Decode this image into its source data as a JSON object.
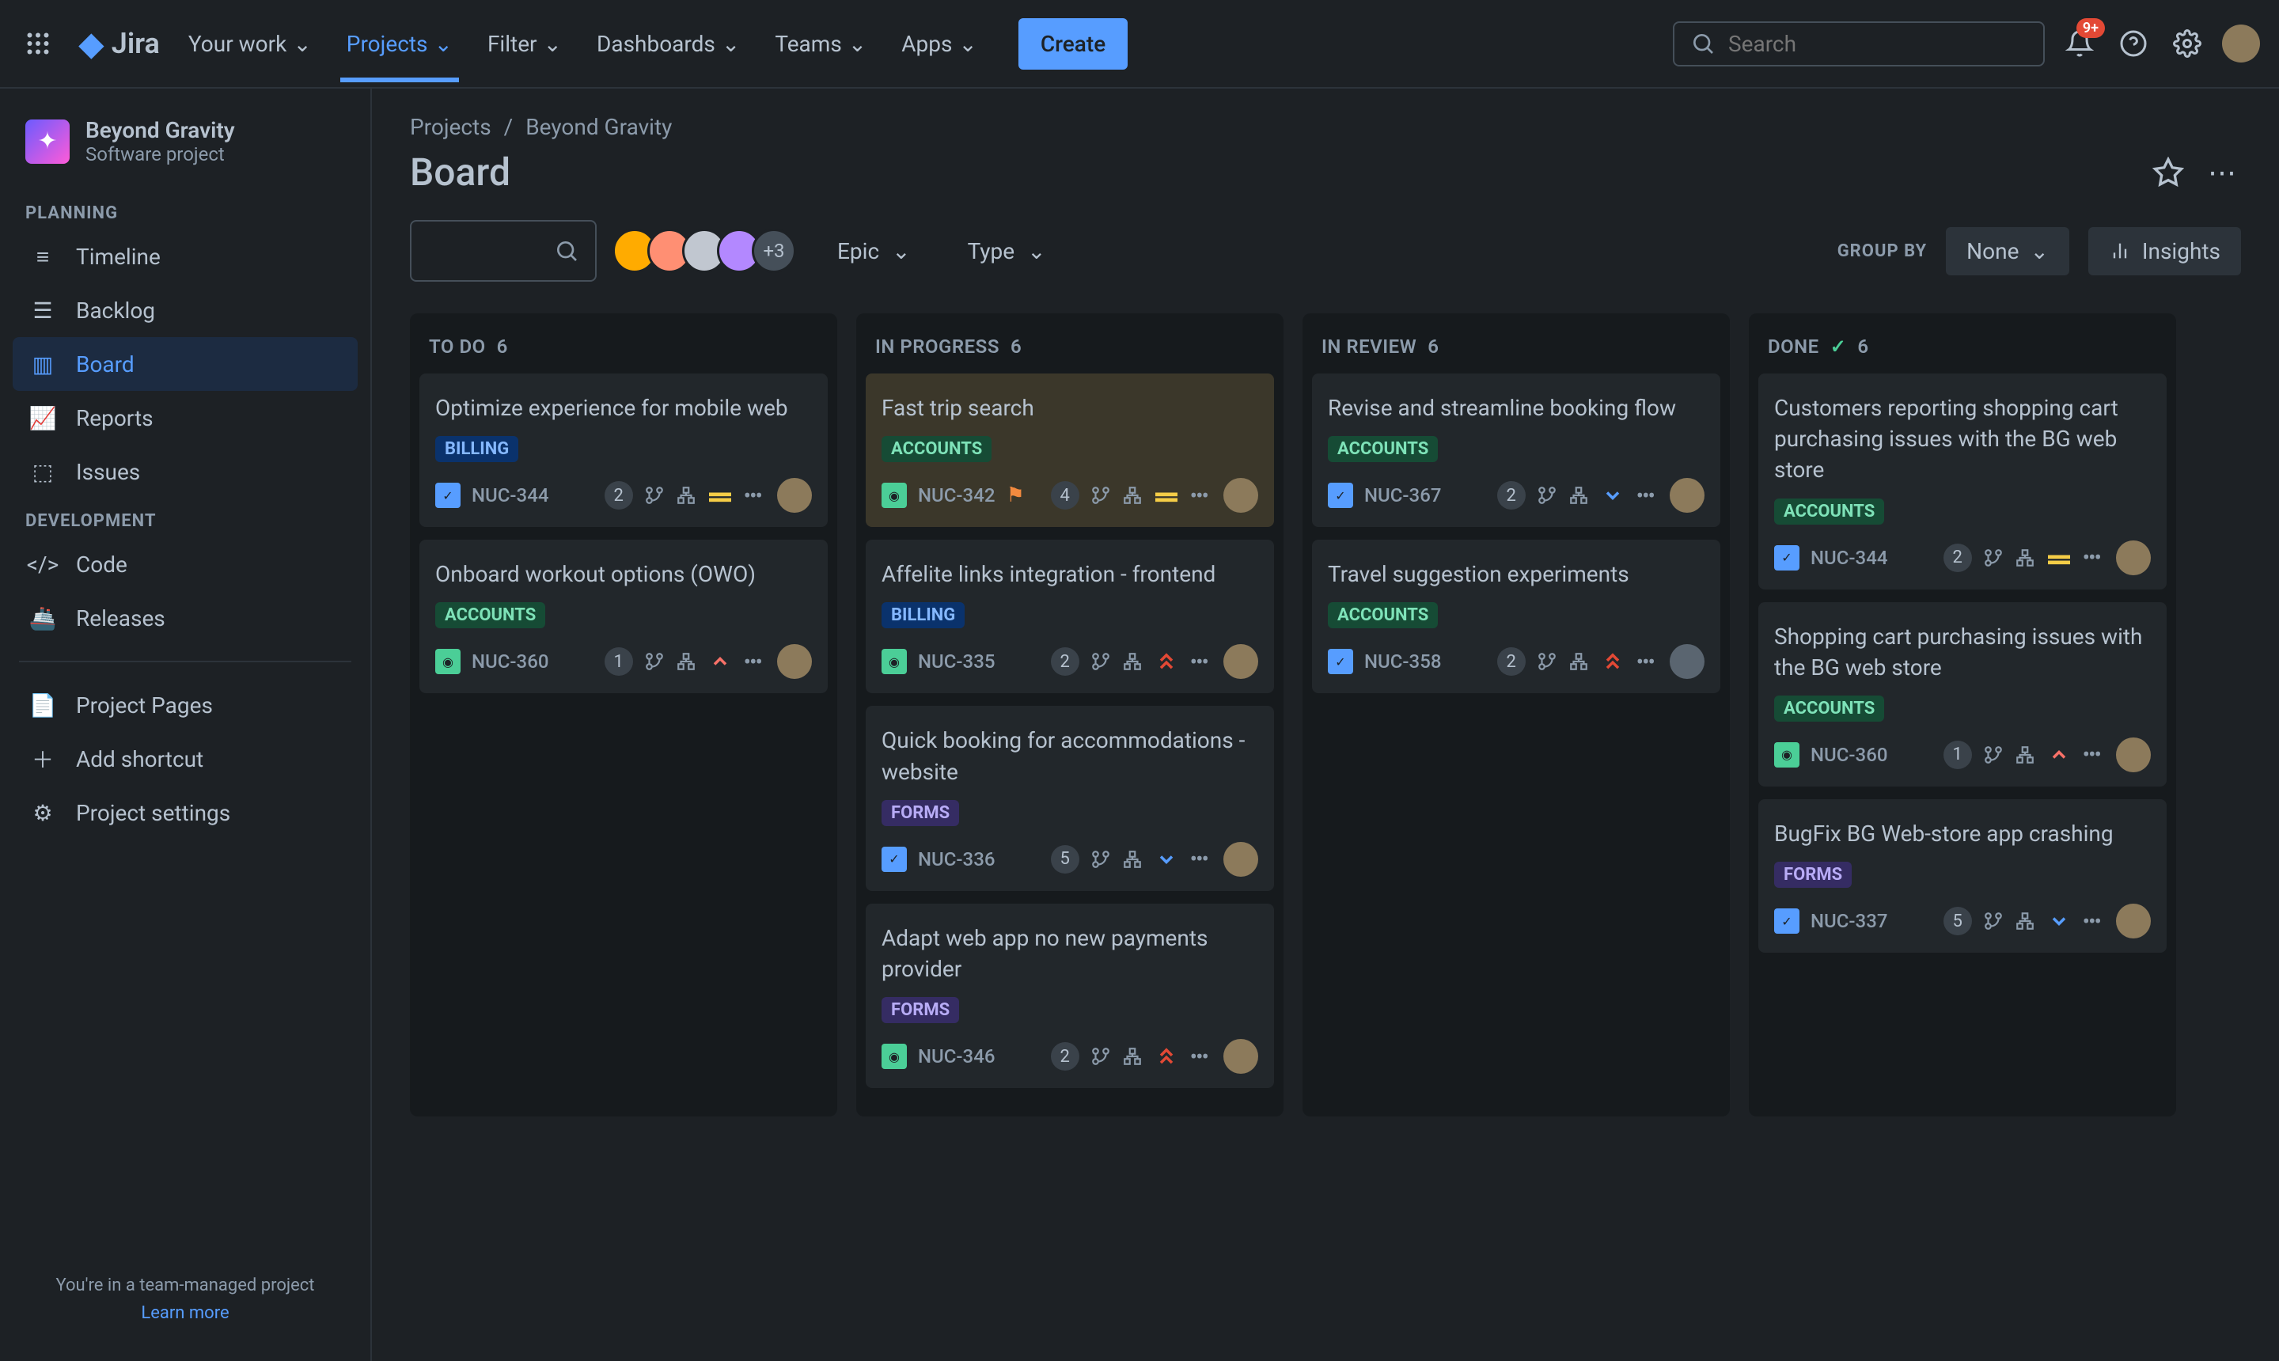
{
  "topbar": {
    "logo": "Jira",
    "nav": [
      "Your work",
      "Projects",
      "Filter",
      "Dashboards",
      "Teams",
      "Apps"
    ],
    "create": "Create",
    "search_placeholder": "Search",
    "notification_badge": "9+"
  },
  "sidebar": {
    "project_name": "Beyond Gravity",
    "project_sub": "Software project",
    "sections": {
      "planning": {
        "label": "PLANNING",
        "items": [
          "Timeline",
          "Backlog",
          "Board",
          "Reports",
          "Issues"
        ]
      },
      "development": {
        "label": "DEVELOPMENT",
        "items": [
          "Code",
          "Releases"
        ]
      },
      "other": {
        "items": [
          "Project Pages",
          "Add shortcut",
          "Project settings"
        ]
      }
    },
    "footer_text": "You're in a team-managed project",
    "footer_link": "Learn more"
  },
  "main": {
    "breadcrumb": [
      "Projects",
      "Beyond Gravity"
    ],
    "title": "Board",
    "avatar_overflow": "+3",
    "filters": [
      "Epic",
      "Type"
    ],
    "group_by_label": "GROUP BY",
    "group_by_value": "None",
    "insights": "Insights"
  },
  "columns": [
    {
      "name": "TO DO",
      "count": "6",
      "cards": [
        {
          "title": "Optimize experience for mobile web",
          "tag": "BILLING",
          "tag_class": "billing",
          "type": "task",
          "key": "NUC-344",
          "count": "2",
          "priority": "medium",
          "assignee": "a"
        },
        {
          "title": "Onboard workout options (OWO)",
          "tag": "ACCOUNTS",
          "tag_class": "accounts",
          "type": "story",
          "key": "NUC-360",
          "count": "1",
          "priority": "high",
          "assignee": "a"
        }
      ]
    },
    {
      "name": "IN PROGRESS",
      "count": "6",
      "cards": [
        {
          "title": "Fast trip search",
          "tag": "ACCOUNTS",
          "tag_class": "accounts",
          "type": "story",
          "key": "NUC-342",
          "flag": true,
          "count": "4",
          "priority": "medium",
          "assignee": "a",
          "highlight": true
        },
        {
          "title": "Affelite links integration - frontend",
          "tag": "BILLING",
          "tag_class": "billing",
          "type": "story",
          "key": "NUC-335",
          "count": "2",
          "priority": "highest",
          "assignee": "a"
        },
        {
          "title": "Quick booking for accommodations - website",
          "tag": "FORMS",
          "tag_class": "forms",
          "type": "task",
          "key": "NUC-336",
          "count": "5",
          "priority": "low",
          "assignee": "a"
        },
        {
          "title": "Adapt web app no new payments provider",
          "tag": "FORMS",
          "tag_class": "forms",
          "type": "story",
          "key": "NUC-346",
          "count": "2",
          "priority": "highest",
          "assignee": "a"
        }
      ]
    },
    {
      "name": "IN REVIEW",
      "count": "6",
      "cards": [
        {
          "title": "Revise and streamline booking flow",
          "tag": "ACCOUNTS",
          "tag_class": "accounts",
          "type": "task",
          "key": "NUC-367",
          "count": "2",
          "priority": "low",
          "assignee": "a"
        },
        {
          "title": "Travel suggestion experiments",
          "tag": "ACCOUNTS",
          "tag_class": "accounts",
          "type": "task",
          "key": "NUC-358",
          "count": "2",
          "priority": "highest",
          "assignee": "g"
        }
      ]
    },
    {
      "name": "DONE",
      "count": "6",
      "check": true,
      "cards": [
        {
          "title": "Customers reporting shopping cart purchasing issues with the BG web store",
          "tag": "ACCOUNTS",
          "tag_class": "accounts",
          "type": "task",
          "key": "NUC-344",
          "count": "2",
          "priority": "medium",
          "assignee": "a"
        },
        {
          "title": "Shopping cart purchasing issues with the BG web store",
          "tag": "ACCOUNTS",
          "tag_class": "accounts",
          "type": "story",
          "key": "NUC-360",
          "count": "1",
          "priority": "high",
          "assignee": "a"
        },
        {
          "title": "BugFix BG Web-store app crashing",
          "tag": "FORMS",
          "tag_class": "forms",
          "type": "task",
          "key": "NUC-337",
          "count": "5",
          "priority": "low",
          "assignee": "a"
        }
      ]
    }
  ]
}
